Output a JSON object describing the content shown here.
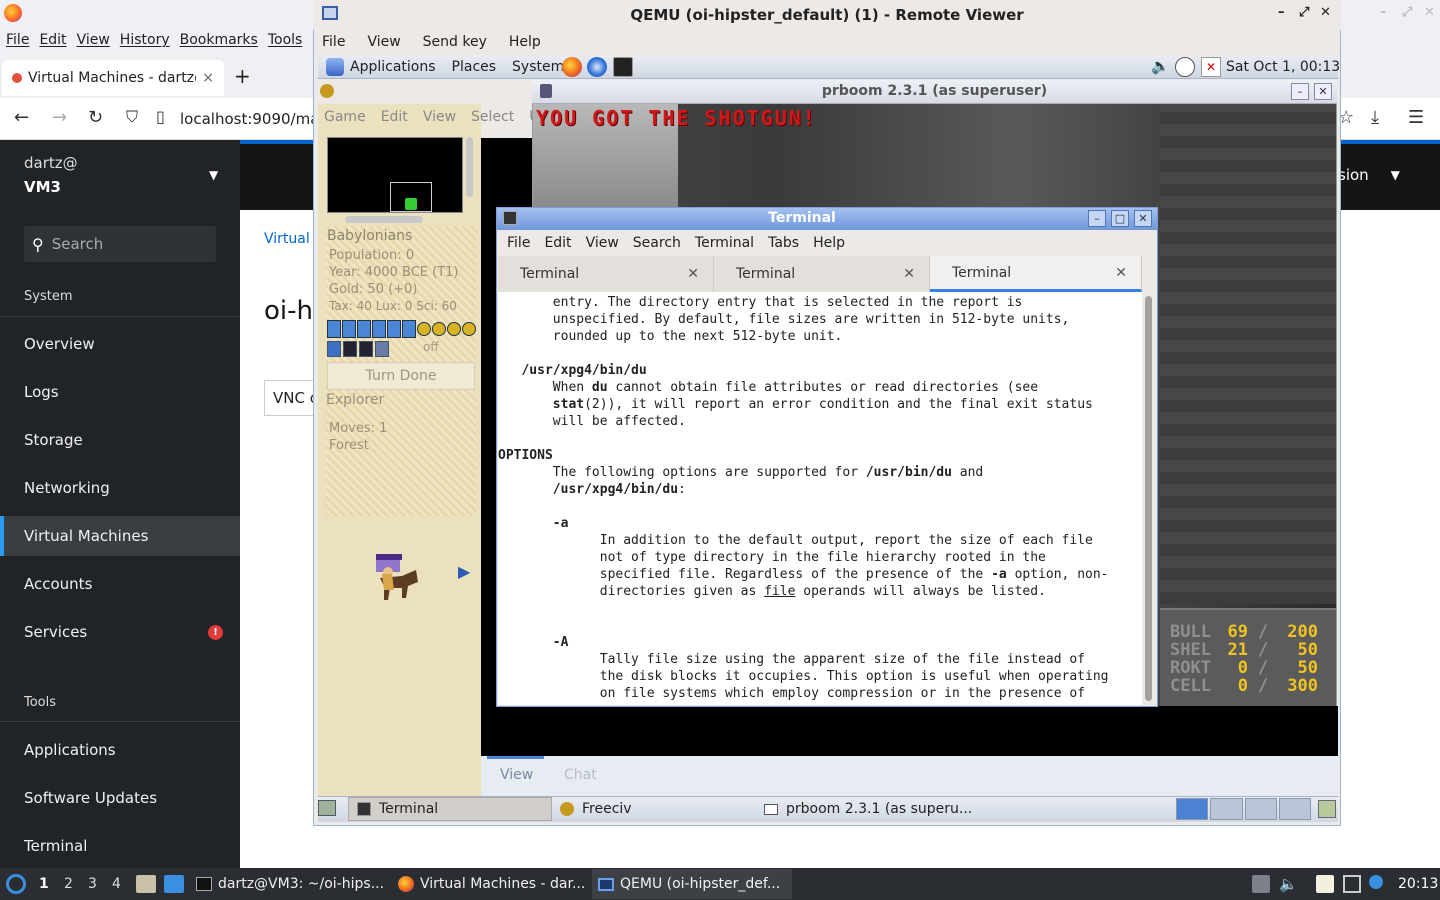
{
  "firefox": {
    "menu": [
      "File",
      "Edit",
      "View",
      "History",
      "Bookmarks",
      "Tools"
    ],
    "tab_title": "Virtual Machines - dartz@",
    "tab_close": "×",
    "new_tab": "+",
    "url": "localhost:9090/ma"
  },
  "cockpit": {
    "user": "dartz@",
    "host": "VM3",
    "search_placeholder": "Search",
    "section_system": "System",
    "section_tools": "Tools",
    "nav": [
      "Overview",
      "Logs",
      "Storage",
      "Networking",
      "Virtual Machines",
      "Accounts",
      "Services"
    ],
    "tools_nav": [
      "Applications",
      "Software Updates",
      "Terminal"
    ],
    "active_item": "Virtual Machines",
    "services_badge": "!",
    "session_label": "sion",
    "breadcrumb": "Virtual r",
    "page_title": "oi-h",
    "vnc_tab": "VNC c"
  },
  "qemu": {
    "title": "QEMU (oi-hipster_default) (1) - Remote Viewer",
    "menu": [
      "File",
      "View",
      "Send key",
      "Help"
    ]
  },
  "guest_panel": {
    "menu": [
      "Applications",
      "Places",
      "System"
    ],
    "clock": "Sat Oct  1, 00:13"
  },
  "freeciv": {
    "menu": [
      "Game",
      "Edit",
      "View",
      "Select",
      "U"
    ],
    "nation": "Babylonians",
    "population": "Population: 0",
    "year": "Year: 4000 BCE (T1)",
    "gold": "Gold: 50 (+0)",
    "tax": "Tax: 40 Lux: 0 Sci: 60",
    "off_label": "off",
    "turn_done": "Turn Done",
    "unit_type": "Explorer",
    "moves": "Moves: 1",
    "terrain": "Forest",
    "tab_view": "View",
    "tab_chat": "Chat"
  },
  "doom": {
    "title": "prboom 2.3.1 (as superuser)",
    "message": "YOU GOT THE SHOTGUN!",
    "hud": [
      {
        "label": "BULL",
        "current": "69",
        "max": "200"
      },
      {
        "label": "SHEL",
        "current": "21",
        "max": "50"
      },
      {
        "label": "ROKT",
        "current": "0",
        "max": "50"
      },
      {
        "label": "CELL",
        "current": "0",
        "max": "300"
      }
    ],
    "hud_sep": "/"
  },
  "terminal": {
    "title": "Terminal",
    "menu": [
      "File",
      "Edit",
      "View",
      "Search",
      "Terminal",
      "Tabs",
      "Help"
    ],
    "tabs": [
      "Terminal",
      "Terminal",
      "Terminal"
    ],
    "tab_close": "✕",
    "lines": [
      "       entry. The directory entry that is selected in the report is",
      "       unspecified. By default, file sizes are written in 512-byte units,",
      "       rounded up to the next 512-byte unit.",
      "",
      "   /usr/xpg4/bin/du",
      "       When du cannot obtain file attributes or read directories (see",
      "       stat(2)), it will report an error condition and the final exit status",
      "       will be affected.",
      "",
      "OPTIONS",
      "       The following options are supported for /usr/bin/du and",
      "       /usr/xpg4/bin/du:",
      "",
      "       -a",
      "             In addition to the default output, report the size of each file",
      "             not of type directory in the file hierarchy rooted in the",
      "             specified file. Regardless of the presence of the -a option, non-",
      "             directories given as file operands will always be listed.",
      "",
      "",
      "       -A",
      "             Tally file size using the apparent size of the file instead of",
      "             the disk blocks it occupies. This option is useful when operating",
      "             on file systems which employ compression or in the presence of",
      "",
      ":"
    ]
  },
  "guest_taskbar": {
    "items": [
      "Terminal",
      "Freeciv",
      "prboom 2.3.1 (as superu..."
    ]
  },
  "host_taskbar": {
    "workspaces": [
      "1",
      "2",
      "3",
      "4"
    ],
    "tasks": [
      "dartz@VM3: ~/oi-hips...",
      "Virtual Machines - dar...",
      "QEMU (oi-hipster_def..."
    ],
    "clock": "20:13"
  }
}
